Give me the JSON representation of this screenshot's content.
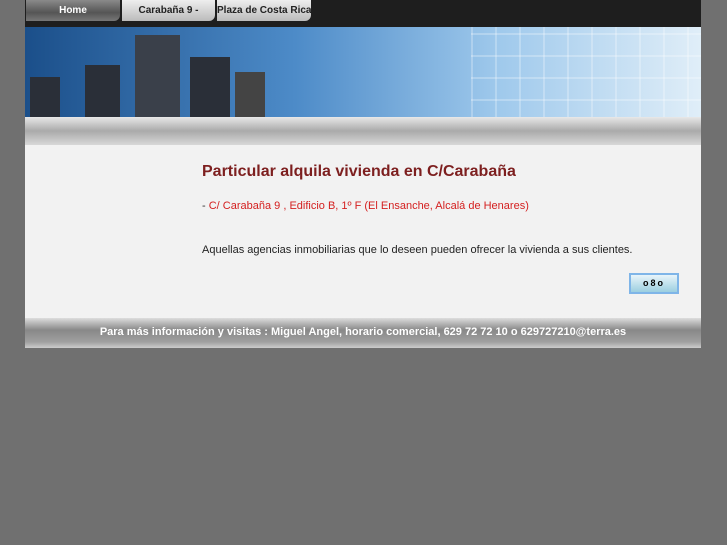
{
  "nav": {
    "tabs": [
      {
        "label": "Home"
      },
      {
        "label": "Carabaña 9 -"
      },
      {
        "label": "Plaza de Costa Rica"
      }
    ]
  },
  "main": {
    "title": "Particular alquila vivienda en C/Carabaña",
    "address_prefix": "- ",
    "address": "C/ Carabaña 9 , Edificio B, 1º F (El Ensanche, Alcalá de Henares)",
    "description": "Aquellas agencias inmobiliarias que lo deseen pueden ofrecer la vivienda a sus clientes.",
    "button_label": "o8o"
  },
  "footer": {
    "text": "Para más información y visitas : Miguel Angel, horario comercial, 629 72 72 10 o 629727210@terra.es"
  }
}
